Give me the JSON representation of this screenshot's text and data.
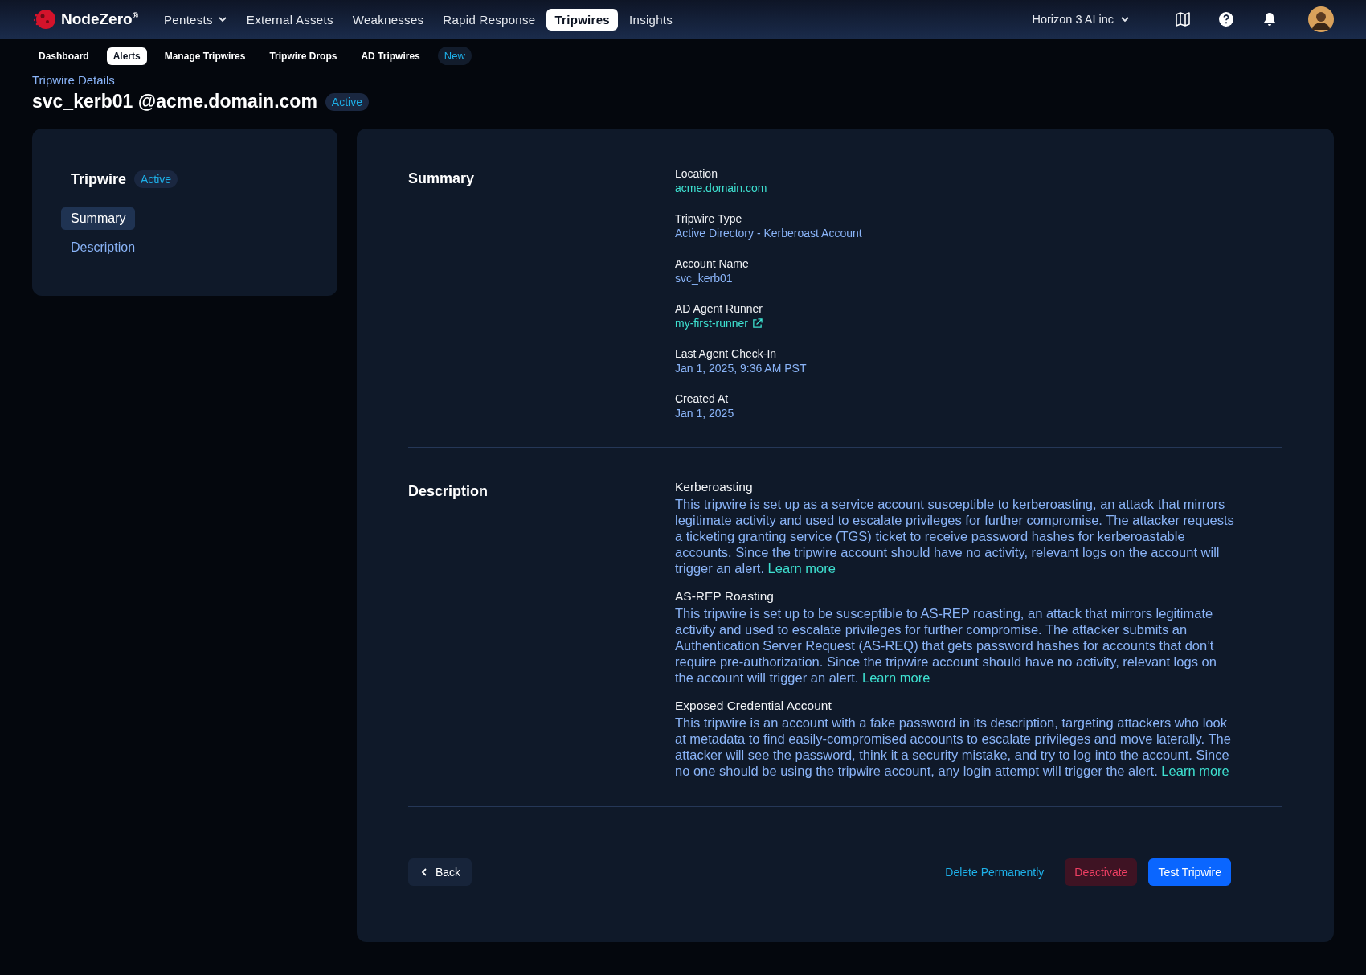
{
  "brand": {
    "name": "NodeZero",
    "mark": "®"
  },
  "nav": [
    {
      "label": "Pentests",
      "selected": false,
      "dropdown": true
    },
    {
      "label": "External Assets",
      "selected": false,
      "dropdown": false
    },
    {
      "label": "Weaknesses",
      "selected": false,
      "dropdown": false
    },
    {
      "label": "Rapid Response",
      "selected": false,
      "dropdown": false
    },
    {
      "label": "Tripwires",
      "selected": true,
      "dropdown": false
    },
    {
      "label": "Insights",
      "selected": false,
      "dropdown": false
    }
  ],
  "org": {
    "label": "Horizon 3 AI inc"
  },
  "subnav": [
    {
      "label": "Dashboard",
      "selected": false
    },
    {
      "label": "Alerts",
      "selected": true
    },
    {
      "label": "Manage Tripwires",
      "selected": false
    },
    {
      "label": "Tripwire Drops",
      "selected": false
    },
    {
      "label": "AD Tripwires",
      "selected": false
    }
  ],
  "subnav_badge": "New",
  "breadcrumb": "Tripwire Details",
  "page_title": "svc_kerb01 @acme.domain.com",
  "page_status": "Active",
  "sidebar": {
    "title": "Tripwire",
    "status": "Active",
    "items": [
      {
        "label": "Summary",
        "selected": true
      },
      {
        "label": "Description",
        "selected": false
      }
    ]
  },
  "summary": {
    "heading": "Summary",
    "fields": [
      {
        "label": "Location",
        "value": "acme.domain.com",
        "kind": "link"
      },
      {
        "label": "Tripwire Type",
        "value": "Active Directory - Kerberoast Account",
        "kind": "text"
      },
      {
        "label": "Account Name",
        "value": "svc_kerb01",
        "kind": "text"
      },
      {
        "label": "AD Agent Runner",
        "value": "my-first-runner",
        "kind": "external"
      },
      {
        "label": "Last Agent Check-In",
        "value": "Jan 1, 2025, 9:36 AM PST",
        "kind": "text"
      },
      {
        "label": "Created At",
        "value": "Jan 1, 2025",
        "kind": "text"
      }
    ]
  },
  "description": {
    "heading": "Description",
    "sections": [
      {
        "title": "Kerberoasting",
        "text": "This tripwire is set up as a service account susceptible to kerberoasting, an attack that mirrors legitimate activity and used to escalate privileges for further compromise. The attacker requests a ticketing granting service (TGS) ticket to receive password hashes for kerberoastable accounts. Since the tripwire account should have no activity, relevant logs on the account will trigger an alert.",
        "link": "Learn more"
      },
      {
        "title": "AS-REP Roasting",
        "text": "This tripwire is set up to be susceptible to AS-REP roasting, an attack that mirrors legitimate activity and used to escalate privileges for further compromise. The attacker submits an Authentication Server Request (AS-REQ) that gets password hashes for accounts that don’t require pre-authorization. Since the tripwire account should have no activity, relevant logs on the account will trigger an alert.",
        "link": "Learn more"
      },
      {
        "title": "Exposed Credential Account",
        "text": "This tripwire is an account with a fake password in its description, targeting attackers who look at metadata to find easily-compromised accounts to escalate privileges and move laterally. The attacker will see the password, think it a security mistake, and try to log into the account. Since no one should be using the tripwire account, any login attempt will trigger the alert.",
        "link": "Learn more"
      }
    ]
  },
  "actions": {
    "back": "Back",
    "buttons": [
      {
        "label": "Delete Permanently",
        "kind": "link"
      },
      {
        "label": "Deactivate",
        "kind": "danger"
      },
      {
        "label": "Test Tripwire",
        "kind": "primary"
      }
    ]
  }
}
